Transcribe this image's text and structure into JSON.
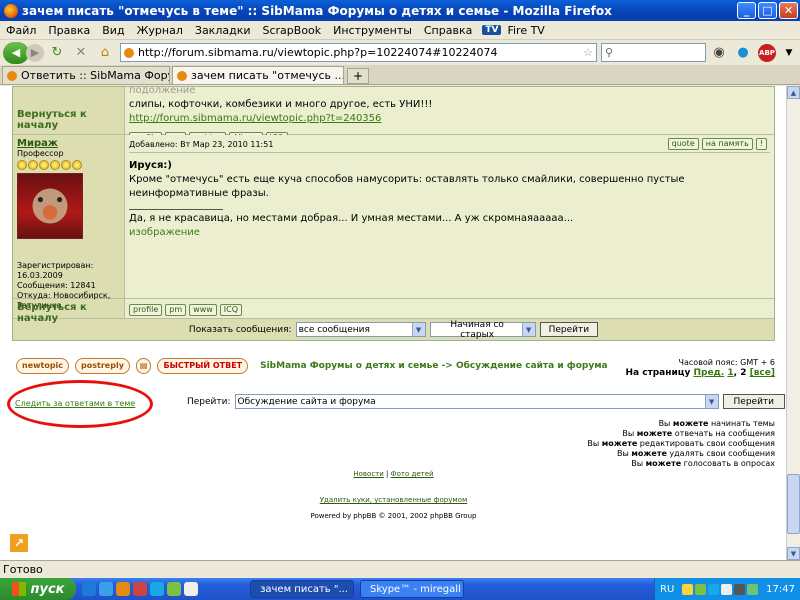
{
  "window": {
    "title": "зачем писать \"отмечусь в теме\" :: SibMama Форумы о детях и семье - Mozilla Firefox"
  },
  "menu": [
    "Файл",
    "Правка",
    "Вид",
    "Журнал",
    "Закладки",
    "ScrapBook",
    "Инструменты",
    "Справка",
    "Fire TV"
  ],
  "menu_tv_badge": "TV",
  "nav": {
    "url": "http://forum.sibmama.ru/viewtopic.php?p=10224074#10224074",
    "abp": "ABP"
  },
  "tabs": [
    {
      "label": "Ответить :: SibMama Форум...",
      "active": false
    },
    {
      "label": "зачем писать \"отмечусь ...",
      "active": true
    }
  ],
  "post1": {
    "line0": "подолжение",
    "line1": "слипы, кофточки, комбезики и много другое, есть УНИ!!!",
    "link": "http://forum.sibmama.ru/viewtopic.php?t=240356",
    "back": "Вернуться к началу",
    "buttons": [
      "profile",
      "pm",
      "weblog",
      "Album",
      "ICQ"
    ]
  },
  "post2": {
    "author": "Мираж",
    "rank": "Профессор",
    "posted": "Добавлено: Вт Мар 23, 2010 11:51",
    "quote_btn": "quote",
    "memo_btn": "на память",
    "quote_author": "Ируся:)",
    "body": "Кроме \"отмечусь\" есть еще куча способов намусорить: оставлять только смайлики, совершенно пустые неинформативные фразы.",
    "sig": "Да, я не красавица, но местами добрая... И умная местами... А уж скромнаяааааа...",
    "img_link": "изображение",
    "registered_label": "Зарегистрирован:",
    "registered": "16.03.2009",
    "posts": "Сообщения: 12841",
    "from": "Откуда: Новосибирск, Затулинка",
    "back": "Вернуться к началу",
    "buttons": [
      "profile",
      "pm",
      "www",
      "ICQ"
    ]
  },
  "filter": {
    "label": "Показать сообщения:",
    "show": "все сообщения",
    "order": "Начиная со старых",
    "go": "Перейти"
  },
  "bottom": {
    "newtopic": "newtopic",
    "postreply": "postreply",
    "quick": "БЫСТРЫЙ ОТВЕТ",
    "path": "SibMama Форумы о детях и семье -> Обсуждение сайта и форума",
    "tz": "Часовой пояс: GMT + 6",
    "pages_label": "На страницу",
    "prev": "Пред.",
    "p1": "1",
    "p2": "2",
    "all": "[все]",
    "watch": "Следить за ответами в теме",
    "jump_label": "Перейти:",
    "jump_value": "Обсуждение сайта и форума",
    "jump_go": "Перейти"
  },
  "perms": [
    {
      "pre": "Вы ",
      "bold": "можете",
      "post": " начинать темы"
    },
    {
      "pre": "Вы ",
      "bold": "можете",
      "post": " отвечать на сообщения"
    },
    {
      "pre": "Вы ",
      "bold": "можете",
      "post": " редактировать свои сообщения"
    },
    {
      "pre": "Вы ",
      "bold": "можете",
      "post": " удалять свои сообщения"
    },
    {
      "pre": "Вы ",
      "bold": "можете",
      "post": " голосовать в опросах"
    }
  ],
  "footer": {
    "news": "Новости",
    "sep": " | ",
    "photos": "Фото детей",
    "cookies": "Удалить куки, установленные форумом",
    "powered": "Powered by phpBB © 2001, 2002 phpBB Group"
  },
  "status": "Готово",
  "taskbar": {
    "start": "пуск",
    "tasks": [
      "зачем писать \"...",
      "Skype™ - miregall"
    ],
    "lang": "RU",
    "time": "17:47"
  }
}
